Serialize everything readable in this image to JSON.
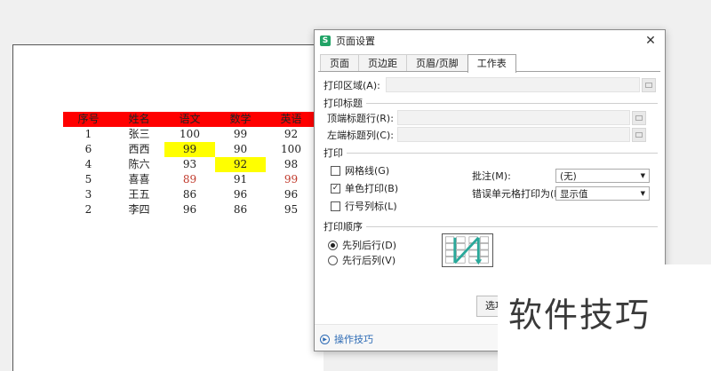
{
  "sheet": {
    "headers": [
      "序号",
      "姓名",
      "语文",
      "数学",
      "英语"
    ],
    "rows": [
      [
        "1",
        "张三",
        "100",
        "99",
        "92"
      ],
      [
        "6",
        "西西",
        "99",
        "90",
        "100"
      ],
      [
        "4",
        "陈六",
        "93",
        "92",
        "98"
      ],
      [
        "5",
        "喜喜",
        "89",
        "91",
        "99"
      ],
      [
        "3",
        "王五",
        "86",
        "96",
        "96"
      ],
      [
        "2",
        "李四",
        "96",
        "86",
        "95"
      ]
    ],
    "highlight_color": "#ffff00",
    "header_color": "#ff0000",
    "emphasis_text_color": "#c0392b"
  },
  "dialog": {
    "icon_letter": "S",
    "title": "页面设置",
    "close_symbol": "✕",
    "tabs": [
      "页面",
      "页边距",
      "页眉/页脚",
      "工作表"
    ],
    "active_tab": "工作表",
    "print_area_label": "打印区域(A):",
    "print_titles_section": "打印标题",
    "top_rows_label": "顶端标题行(R):",
    "left_cols_label": "左端标题列(C):",
    "print_section": "打印",
    "gridlines_label": "网格线(G)",
    "gridlines_checked": false,
    "mono_label": "单色打印(B)",
    "mono_checked": true,
    "rowcol_label": "行号列标(L)",
    "rowcol_checked": false,
    "comments_label": "批注(M):",
    "comments_value": "(无)",
    "errors_label": "错误单元格打印为(E):",
    "errors_value": "显示值",
    "order_section": "打印顺序",
    "down_then_over_label": "先列后行(D)",
    "down_then_over_selected": true,
    "over_then_down_label": "先行后列(V)",
    "over_then_down_selected": false,
    "options_button": "选项",
    "tips_link": "操作技巧"
  },
  "watermark": {
    "text": "软件技巧"
  }
}
